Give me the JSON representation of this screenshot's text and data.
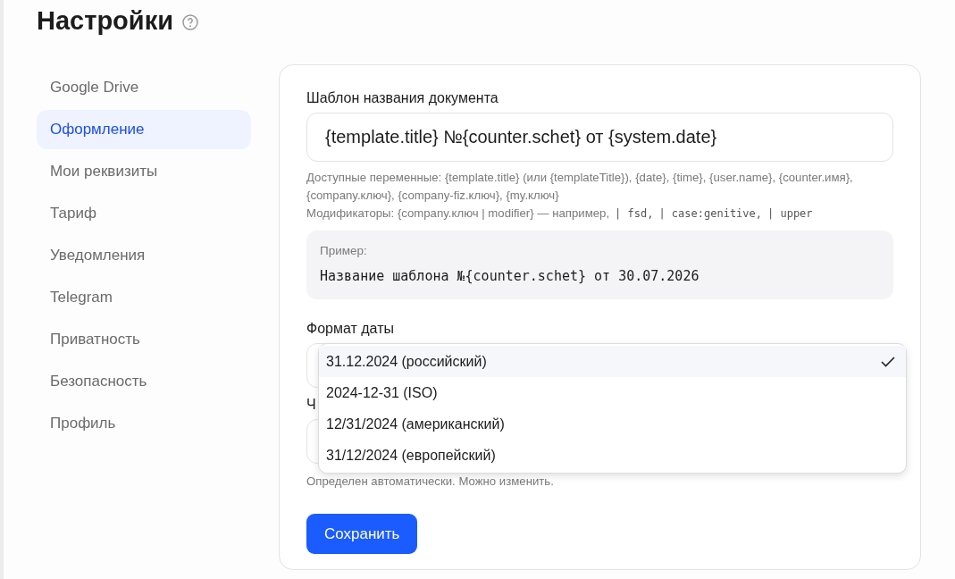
{
  "page": {
    "title": "Настройки"
  },
  "sidebar": {
    "items": [
      {
        "label": "Google Drive",
        "selected": false
      },
      {
        "label": "Оформление",
        "selected": true
      },
      {
        "label": "Мои реквизиты",
        "selected": false
      },
      {
        "label": "Тариф",
        "selected": false
      },
      {
        "label": "Уведомления",
        "selected": false
      },
      {
        "label": "Telegram",
        "selected": false
      },
      {
        "label": "Приватность",
        "selected": false
      },
      {
        "label": "Безопасность",
        "selected": false
      },
      {
        "label": "Профиль",
        "selected": false
      }
    ]
  },
  "template": {
    "label": "Шаблон названия документа",
    "value": "{template.title} №{counter.schet} от {system.date}",
    "hint_variables": "Доступные переменные: {template.title} (или {templateTitle}), {date}, {time}, {user.name}, {counter.имя}, {company.ключ}, {company-fiz.ключ}, {my.ключ}",
    "hint_modifiers": {
      "prefix": "Модификаторы: {company.ключ | modifier} — например,",
      "examples": [
        "| fsd,",
        "| case:genitive,",
        "| upper"
      ]
    },
    "example": {
      "label": "Пример:",
      "value": "Название шаблона №{counter.schet} от 30.07.2026"
    }
  },
  "date_format": {
    "label": "Формат даты",
    "expanded": true,
    "options": [
      {
        "label": "31.12.2024 (российский)",
        "selected": true
      },
      {
        "label": "2024-12-31 (ISO)",
        "selected": false
      },
      {
        "label": "12/31/2024 (американский)",
        "selected": false
      },
      {
        "label": "31/12/2024 (европейский)",
        "selected": false
      }
    ]
  },
  "timezone": {
    "label": "Ч",
    "hint": "Определен автоматически. Можно изменить."
  },
  "save_button": "Сохранить"
}
